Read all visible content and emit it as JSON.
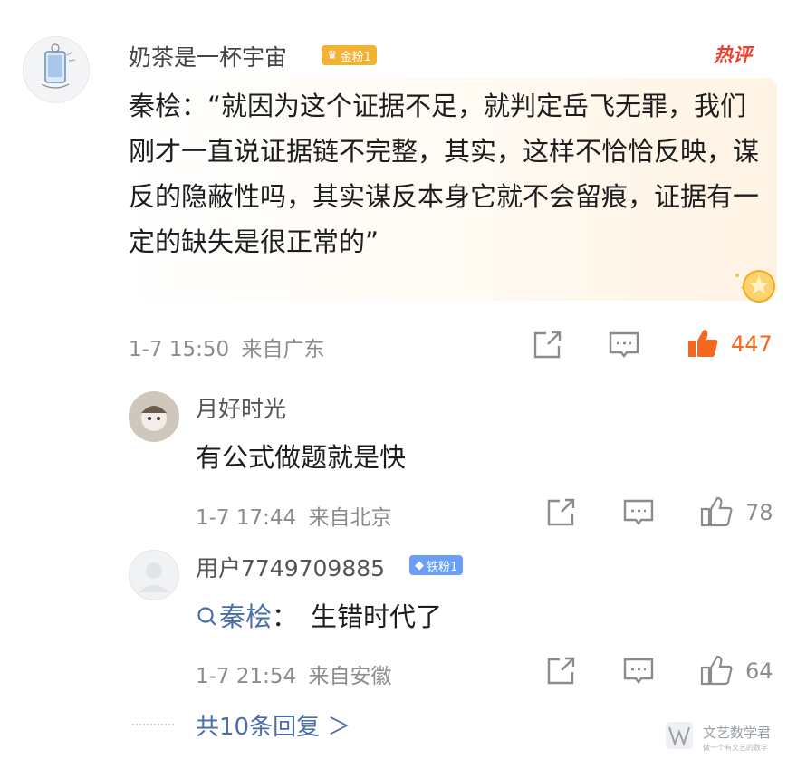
{
  "comment": {
    "username": "奶茶是一杯宇宙",
    "badge": "金粉1",
    "hot_label": "热评",
    "text": "秦桧：“就因为这个证据不足，就判定岳飞无罪，我们刚才一直说证据链不完整，其实，这样不恰恰反映，谋反的隐蔽性吗，其实谋反本身它就不会留痕，证据有一定的缺失是很正常的”",
    "time": "1-7 15:50",
    "location": "来自广东",
    "likes": "447"
  },
  "replies": [
    {
      "username": "月好时光",
      "text": "有公式做题就是快",
      "time": "1-7 17:44",
      "location": "来自北京",
      "likes": "78"
    },
    {
      "username": "用户7749709885",
      "badge": "铁粉1",
      "mention": "秦桧",
      "mention_suffix": "：",
      "text": "生错时代了",
      "time": "1-7 21:54",
      "location": "来自安徽",
      "likes": "64"
    }
  ],
  "more_replies": "共10条回复 ＞",
  "watermark": {
    "title": "文艺数学君",
    "subtitle": "做一个有文艺的数学"
  },
  "colors": {
    "like_active": "#f26a21",
    "link": "#4a6ea8",
    "hot": "#e8412f"
  },
  "icons": [
    "share-icon",
    "comment-icon",
    "like-icon",
    "search-icon",
    "chevron-right-icon"
  ]
}
